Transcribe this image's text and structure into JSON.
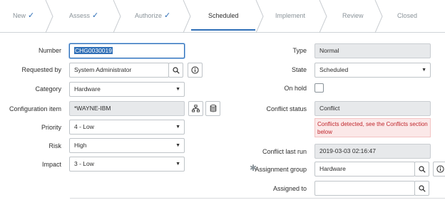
{
  "workflow": {
    "stages": [
      {
        "label": "New",
        "done": true
      },
      {
        "label": "Assess",
        "done": true
      },
      {
        "label": "Authorize",
        "done": true
      },
      {
        "label": "Scheduled",
        "done": false,
        "active": true
      },
      {
        "label": "Implement",
        "done": false
      },
      {
        "label": "Review",
        "done": false
      },
      {
        "label": "Closed",
        "done": false
      }
    ],
    "check_glyph": "✓"
  },
  "form": {
    "number": {
      "label": "Number",
      "value": "CHG0030019"
    },
    "requested_by": {
      "label": "Requested by",
      "value": "System Administrator"
    },
    "category": {
      "label": "Category",
      "value": "Hardware"
    },
    "configuration_item": {
      "label": "Configuration item",
      "value": "*WAYNE-IBM"
    },
    "priority": {
      "label": "Priority",
      "value": "4 - Low"
    },
    "risk": {
      "label": "Risk",
      "value": "High"
    },
    "impact": {
      "label": "Impact",
      "value": "3 - Low"
    },
    "type": {
      "label": "Type",
      "value": "Normal"
    },
    "state": {
      "label": "State",
      "value": "Scheduled"
    },
    "on_hold": {
      "label": "On hold",
      "checked": false
    },
    "conflict_status": {
      "label": "Conflict status",
      "value": "Conflict",
      "alert": "Conflicts detected, see the Conflicts section below"
    },
    "conflict_last_run": {
      "label": "Conflict last run",
      "value": "2019-03-03 02:16:47"
    },
    "assignment_group": {
      "label": "Assignment group",
      "value": "Hardware",
      "required": true
    },
    "assigned_to": {
      "label": "Assigned to",
      "value": ""
    }
  },
  "colors": {
    "accent": "#2f6fb7",
    "error_bg": "#fbe8e8",
    "error_text": "#c0272d",
    "readonly_bg": "#e7e9eb"
  },
  "icons": {
    "search": "search-icon",
    "info": "info-icon",
    "hierarchy": "hierarchy-icon",
    "database": "database-icon",
    "dropdown": "chevron-down-icon",
    "required": "asterisk-icon"
  }
}
